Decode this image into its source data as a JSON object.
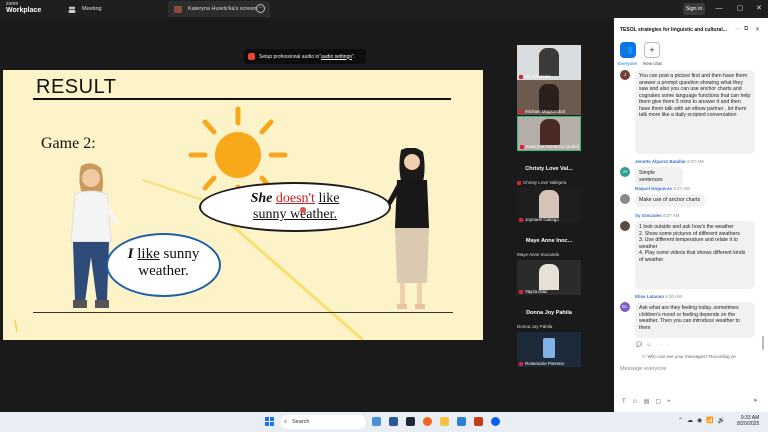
{
  "titlebar": {
    "logo_top": "zoom",
    "logo_bottom": "Workplace",
    "tabs": [
      {
        "label": "Meeting"
      },
      {
        "label": "Kateryna Hurets'ka's screen"
      }
    ],
    "signin_label": "Sign in"
  },
  "audio_banner": {
    "text": "Setup professional audio in ",
    "link": "audio settings",
    "suffix": "."
  },
  "slide": {
    "title": "RESULT",
    "game_label": "Game 2:",
    "bubble_right": {
      "w1": "She",
      "w2": "doesn't",
      "w3": "like",
      "line2": "sunny weather."
    },
    "bubble_left": {
      "w1": "I",
      "w2": "like",
      "w3": "sunny",
      "line2": "weather."
    }
  },
  "participants": {
    "tiles": [
      {
        "name": "Sy Gonzales"
      },
      {
        "name": "Michael Magsombol"
      },
      {
        "name": "Kateryna Hurets'ka (audio)"
      }
    ],
    "groups": [
      {
        "heading": "Christy Love Val...",
        "sub": "Christy Love Vallejera",
        "tile_name": "Joynarel Gallego"
      },
      {
        "heading": "Maye Anne Inoc...",
        "sub": "Maye Anne Inocando",
        "tile_name": "Yayza Diaz"
      },
      {
        "heading": "Donna Joy Pahila",
        "sub": "Donna Joy Pahila",
        "tile_name": "Rosemarie Parreno"
      }
    ]
  },
  "chat": {
    "title": "TESOL strategies for linguistic and cultural...",
    "everyone_label": "Everyone",
    "newchat_label": "New chat",
    "messages": [
      {
        "sender": "",
        "time": "",
        "avatar": "J",
        "text": "You can post a picture first and then have them answer a prompt question showing what they saw and also you can use anchor charts and cognates some language functions that can help them give them 5 mins to answer it and then have them talk with an elbow partner , let them talk more like a daily scripted conversation"
      },
      {
        "sender": "Jenette Alparez  Batallar",
        "time": "9:27 AM",
        "avatar": "JA",
        "text": "Simple sentences"
      },
      {
        "sender": "Raquel Nogueras",
        "time": "9:27 AM",
        "avatar": "",
        "text": "Make use of anchor charts"
      },
      {
        "sender": "Sy Gonzales",
        "time": "9:27 AM",
        "avatar": "",
        "text": "1 look outside and ask how's the weather\n2. Show some pictures of different weathers\n3. Use different temperature and relate it to weather\n4. Play some videos that shows different kinds of weather"
      },
      {
        "sender": "Elise Lataoan",
        "time": "9:30 AM",
        "avatar": "EL",
        "text": "Ask what are they feeling today..sometimes children's mood or feeling depends on the weather. Then you can introduce weather to them"
      }
    ],
    "privacy_text": "Who can see your messages? Recording on",
    "compose_placeholder": "Message everyone"
  },
  "taskbar": {
    "search_placeholder": "Search",
    "time": "9:33 AM",
    "date": "8/20/2025"
  },
  "colors": {
    "zoom_blue": "#0e72ed",
    "slide_bg": "#fdf3c9",
    "sun": "#f4a91c",
    "red_word": "#c82121"
  }
}
